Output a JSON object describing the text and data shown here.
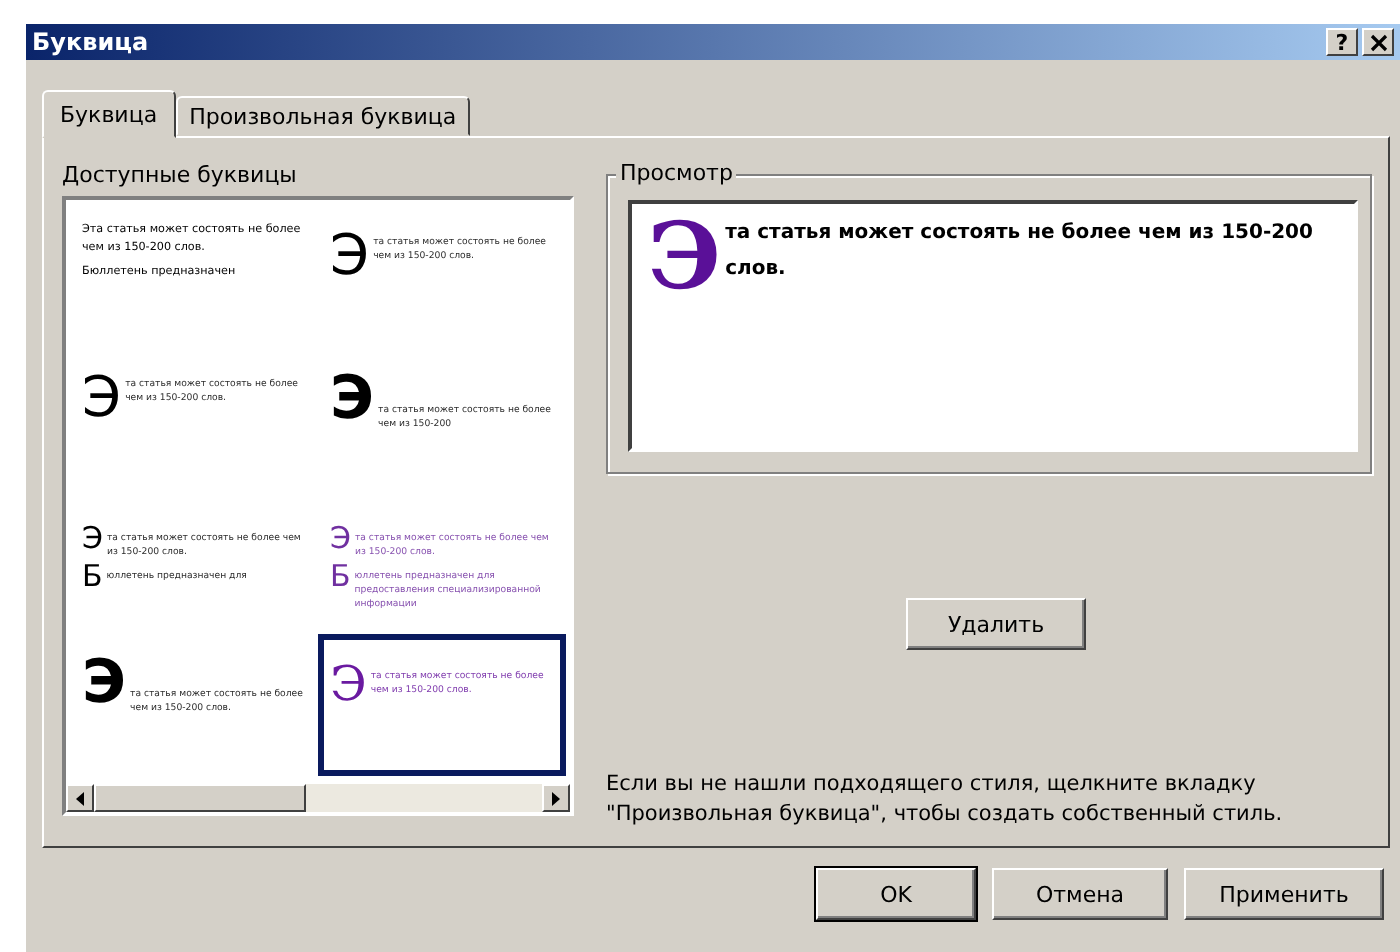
{
  "window": {
    "title": "Буквица",
    "help_button": "?"
  },
  "tabs": [
    {
      "label": "Буквица",
      "selected": true
    },
    {
      "label": "Произвольная буквица",
      "selected": false
    }
  ],
  "gallery": {
    "label": "Доступные буквицы",
    "items": [
      {
        "kind": "plain",
        "cap": "Э",
        "text": "та статья может состоять не более чем из 150-200 слов.",
        "cap2": "Б",
        "text2": "юллетень предназначен",
        "color": "#000000",
        "selected": false
      },
      {
        "kind": "drop",
        "cap": "Э",
        "text": "та статья может состоять не более чем из 150-200 слов.",
        "color": "#000000",
        "selected": false
      },
      {
        "kind": "drop",
        "cap": "Э",
        "text": "та статья может состоять не более чем из 150-200 слов.",
        "color": "#000000",
        "selected": false
      },
      {
        "kind": "raised",
        "cap": "Э",
        "text": "та статья может состоять не более чем из 150-200",
        "color": "#000000",
        "selected": false
      },
      {
        "kind": "small",
        "cap": "Э",
        "text": "та статья может состоять не более чем из 150-200 слов.",
        "cap2": "Б",
        "text2": "юллетень предназначен для",
        "color": "#000000",
        "selected": false
      },
      {
        "kind": "small",
        "cap": "Э",
        "text": "та статья может состоять не более чем из 150-200 слов.",
        "cap2": "Б",
        "text2": "юллетень предназначен для предоставления специализированной информации",
        "color": "#7030a0",
        "selected": false
      },
      {
        "kind": "raised",
        "cap": "Э",
        "text": "та статья может состоять не более чем из 150-200 слов.",
        "color": "#000000",
        "selected": false
      },
      {
        "kind": "serif",
        "cap": "Э",
        "text": "та статья может состоять не более чем из 150-200 слов.",
        "color": "#6a1aa0",
        "selected": true
      }
    ]
  },
  "preview": {
    "label": "Просмотр",
    "cap": "Э",
    "text": "та статья может состоять не более чем из 150-200 слов.",
    "color": "#5a1098"
  },
  "delete_button": "Удалить",
  "hint": "Если вы не нашли подходящего стиля, щелкните вкладку \"Произвольная буквица\", чтобы создать собственный стиль.",
  "buttons": [
    {
      "label": "OK",
      "default": true
    },
    {
      "label": "Отмена",
      "default": false
    },
    {
      "label": "Применить",
      "default": false
    }
  ]
}
